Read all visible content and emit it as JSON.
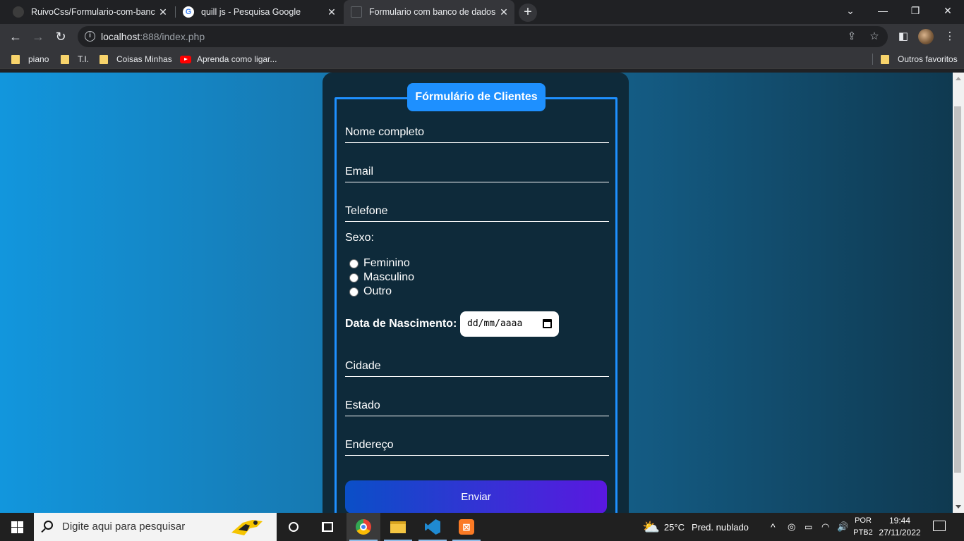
{
  "browser": {
    "tabs": [
      {
        "title": "RuivoCss/Formulario-com-banco",
        "icon": "github-icon",
        "active": false
      },
      {
        "title": "quill js - Pesquisa Google",
        "icon": "google-icon",
        "active": false
      },
      {
        "title": "Formulario com banco de dados",
        "icon": "page-icon",
        "active": true
      }
    ],
    "close_glyph": "✕",
    "new_tab_glyph": "+",
    "url_host": "localhost",
    "url_rest": ":888/index.php",
    "bookmarks": [
      {
        "label": "piano",
        "icon": "folder-icon"
      },
      {
        "label": "T.I.",
        "icon": "folder-icon"
      },
      {
        "label": "Coisas Minhas",
        "icon": "folder-icon"
      },
      {
        "label": "Aprenda como ligar...",
        "icon": "youtube-icon"
      }
    ],
    "other_bookmarks": "Outros favoritos"
  },
  "form": {
    "legend": "Fórmulário de Clientes",
    "fields": {
      "nome": "Nome completo",
      "email": "Email",
      "telefone": "Telefone",
      "cidade": "Cidade",
      "estado": "Estado",
      "endereco": "Endereço"
    },
    "sexo_label": "Sexo:",
    "sexo_options": [
      "Feminino",
      "Masculino",
      "Outro"
    ],
    "data_label": "Data de Nascimento:",
    "data_placeholder": "dd/mm/aaaa",
    "submit_label": "Enviar"
  },
  "taskbar": {
    "search_placeholder": "Digite aqui para pesquisar",
    "weather_temp": "25°C",
    "weather_desc": "Pred. nublado",
    "lang_line1": "POR",
    "lang_line2": "PTB2",
    "time": "19:44",
    "date": "27/11/2022"
  },
  "colors": {
    "legend_bg": "#1e90ff",
    "card_bg": "#0e2a3a",
    "button_gradient_start": "#0a4fc7",
    "button_gradient_end": "#5a18e0"
  }
}
